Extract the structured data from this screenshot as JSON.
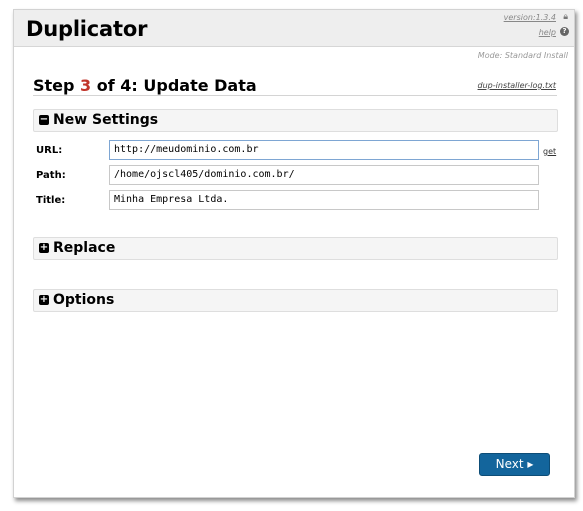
{
  "header": {
    "brand": "Duplicator",
    "version": "version:1.3.4",
    "help": "help",
    "mode": "Mode: Standard Install"
  },
  "step": {
    "prefix": "Step ",
    "number": "3",
    "suffix": " of 4: Update Data",
    "log_link": "dup-installer-log.txt"
  },
  "sections": {
    "new_settings": {
      "toggle": "−",
      "label": "New Settings"
    },
    "replace": {
      "toggle": "+",
      "label": "Replace"
    },
    "options": {
      "toggle": "+",
      "label": "Options"
    }
  },
  "fields": {
    "url": {
      "label": "URL:",
      "value": "http://meudominio.com.br",
      "get_link": "get"
    },
    "path": {
      "label": "Path:",
      "value": "/home/ojscl405/dominio.com.br/"
    },
    "title": {
      "label": "Title:",
      "value": "Minha Empresa Ltda."
    }
  },
  "footer": {
    "next_label": "Next ▸"
  },
  "colors": {
    "step_accent": "#c1342a",
    "next_button": "#13659c"
  }
}
